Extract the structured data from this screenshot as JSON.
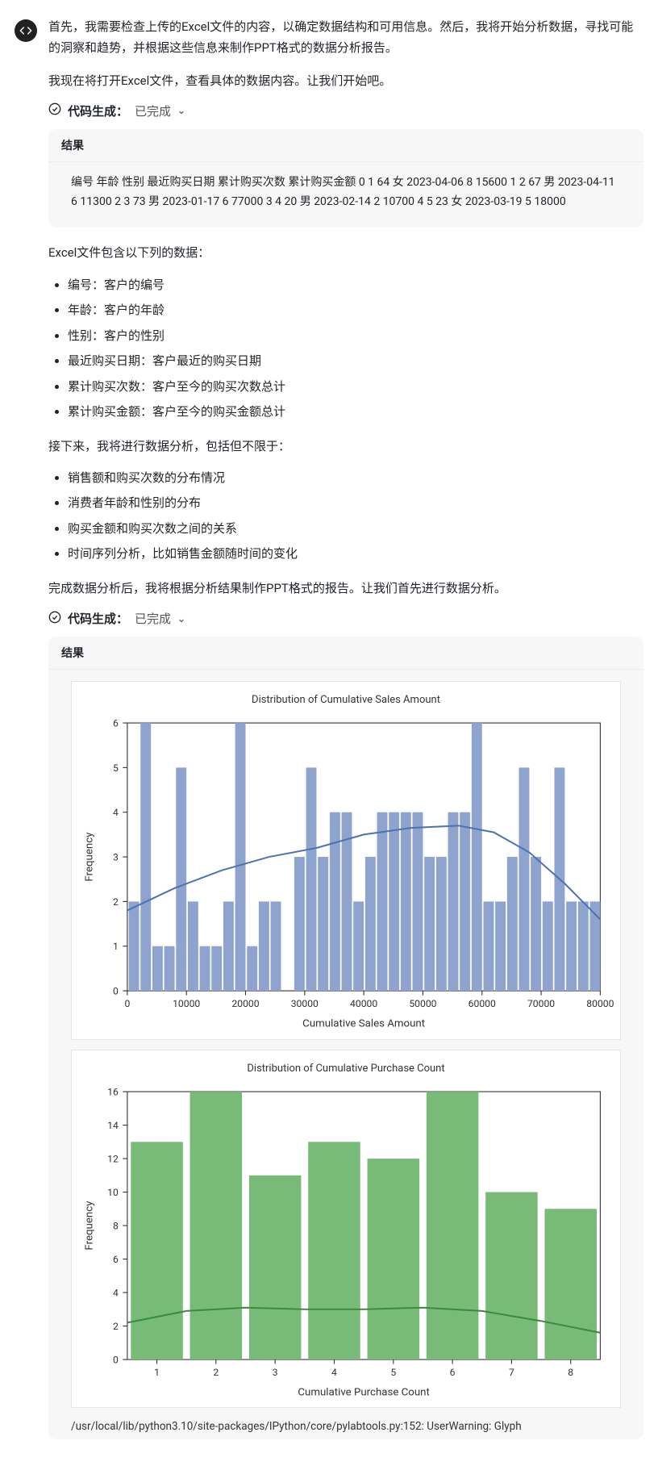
{
  "avatar_name": "code-icon",
  "content": {
    "p1": "首先，我需要检查上传的Excel文件的内容，以确定数据结构和可用信息。然后，我将开始分析数据，寻找可能的洞察和趋势，并根据这些信息来制作PPT格式的数据分析报告。",
    "p2": "我现在将打开Excel文件，查看具体的数据内容。让我们开始吧。",
    "codegen_label": "代码生成：",
    "codegen_status": "已完成",
    "result_label": "结果",
    "result1_body": "编号 年龄 性别 最近购买日期 累计购买次数 累计购买金额 0 1 64 女 2023-04-06 8 15600 1 2 67 男 2023-04-11 6 11300 2 3 73 男 2023-01-17 6 77000 3 4 20 男 2023-02-14 2 10700 4 5 23 女 2023-03-19 5 18000",
    "p3": "Excel文件包含以下列的数据：",
    "col_desc": [
      "编号：客户的编号",
      "年龄：客户的年龄",
      "性别：客户的性别",
      "最近购买日期：客户最近的购买日期",
      "累计购买次数：客户至今的购买次数总计",
      "累计购买金额：客户至今的购买金额总计"
    ],
    "p4": "接下来，我将进行数据分析，包括但不限于：",
    "analysis_items": [
      "销售额和购买次数的分布情况",
      "消费者年龄和性别的分布",
      "购买金额和购买次数之间的关系",
      "时间序列分析，比如销售金额随时间的变化"
    ],
    "p5": "完成数据分析后，我将根据分析结果制作PPT格式的报告。让我们首先进行数据分析。",
    "footer": "/usr/local/lib/python3.10/site-packages/IPython/core/pylabtools.py:152: UserWarning: Glyph"
  },
  "chart_data": [
    {
      "type": "bar",
      "title": "Distribution of Cumulative Sales Amount",
      "xlabel": "Cumulative Sales Amount",
      "ylabel": "Frequency",
      "xlim": [
        0,
        80000
      ],
      "ylim": [
        0,
        6
      ],
      "xticks": [
        0,
        10000,
        20000,
        30000,
        40000,
        50000,
        60000,
        70000,
        80000
      ],
      "yticks": [
        0,
        1,
        2,
        3,
        4,
        5,
        6
      ],
      "x": [
        2000,
        4000,
        6000,
        8000,
        10000,
        12000,
        14000,
        16000,
        18000,
        20000,
        22000,
        24000,
        26000,
        28000,
        30000,
        32000,
        34000,
        36000,
        38000,
        40000,
        42000,
        44000,
        46000,
        48000,
        50000,
        52000,
        54000,
        56000,
        58000,
        60000,
        62000,
        64000,
        66000,
        68000,
        70000,
        72000,
        74000,
        76000,
        78000,
        80000
      ],
      "values": [
        2,
        6,
        1,
        1,
        5,
        2,
        1,
        1,
        2,
        6,
        1,
        2,
        2,
        0,
        3,
        5,
        3,
        4,
        4,
        2,
        3,
        4,
        4,
        4,
        4,
        3,
        3,
        4,
        4,
        6,
        2,
        2,
        3,
        5,
        3,
        2,
        5,
        2,
        2,
        2
      ],
      "kde": [
        {
          "x": 0,
          "y": 1.8
        },
        {
          "x": 8000,
          "y": 2.3
        },
        {
          "x": 16000,
          "y": 2.7
        },
        {
          "x": 24000,
          "y": 3.0
        },
        {
          "x": 32000,
          "y": 3.2
        },
        {
          "x": 40000,
          "y": 3.5
        },
        {
          "x": 48000,
          "y": 3.65
        },
        {
          "x": 56000,
          "y": 3.7
        },
        {
          "x": 62000,
          "y": 3.55
        },
        {
          "x": 68000,
          "y": 3.1
        },
        {
          "x": 74000,
          "y": 2.4
        },
        {
          "x": 80000,
          "y": 1.6
        }
      ]
    },
    {
      "type": "bar",
      "title": "Distribution of Cumulative Purchase Count",
      "xlabel": "Cumulative Purchase Count",
      "ylabel": "Frequency",
      "xlim": [
        0.5,
        8.5
      ],
      "ylim": [
        0,
        16
      ],
      "xticks": [
        1,
        2,
        3,
        4,
        5,
        6,
        7,
        8
      ],
      "yticks": [
        0,
        2,
        4,
        6,
        8,
        10,
        12,
        14,
        16
      ],
      "x": [
        1,
        2,
        3,
        4,
        5,
        6,
        7,
        8
      ],
      "values": [
        13,
        16,
        11,
        13,
        12,
        16,
        10,
        9
      ],
      "kde": [
        {
          "x": 0.5,
          "y": 2.2
        },
        {
          "x": 1.5,
          "y": 2.9
        },
        {
          "x": 2.5,
          "y": 3.1
        },
        {
          "x": 3.5,
          "y": 3.0
        },
        {
          "x": 4.5,
          "y": 3.0
        },
        {
          "x": 5.5,
          "y": 3.1
        },
        {
          "x": 6.5,
          "y": 2.9
        },
        {
          "x": 7.5,
          "y": 2.3
        },
        {
          "x": 8.5,
          "y": 1.6
        }
      ]
    }
  ]
}
